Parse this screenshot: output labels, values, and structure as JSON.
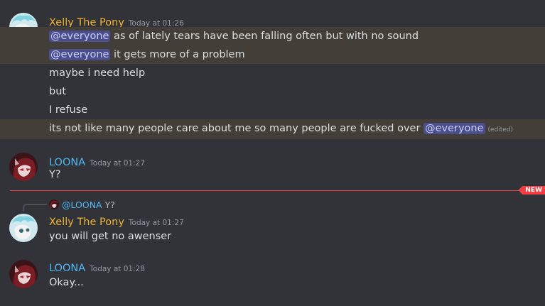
{
  "messages": {
    "group1": {
      "username": "Xelly The Pony",
      "timestamp": "Today at 01:26",
      "username_color": "#f0b232",
      "lines": [
        {
          "mention": "@everyone",
          "text": " as of lately tears have been falling often but with no sound"
        },
        {
          "mention": "@everyone",
          "text": " it gets more of a problem"
        },
        {
          "text": "maybe i need help"
        },
        {
          "text": "but"
        },
        {
          "text": "I refuse"
        },
        {
          "text": "its not like many people care about me so many people are fucked over ",
          "mention": "@everyone",
          "edited": "(edited)"
        }
      ]
    },
    "group2": {
      "username": "LOONA",
      "timestamp": "Today at 01:27",
      "username_color": "#4fb8f5",
      "text": "Y?"
    },
    "group3": {
      "reply": {
        "mention": "@LOONA",
        "text": "Y?"
      },
      "username": "Xelly The Pony",
      "timestamp": "Today at 01:27",
      "text": "you will get no awenser"
    },
    "group4": {
      "username": "LOONA",
      "timestamp": "Today at 01:28",
      "text": "Okay..."
    }
  },
  "divider": {
    "badge": "NEW"
  },
  "colors": {
    "background": "#313338",
    "mention_highlight": "#433e37",
    "mention_pill": "#4a4f8c",
    "new_divider": "#f23f43"
  }
}
